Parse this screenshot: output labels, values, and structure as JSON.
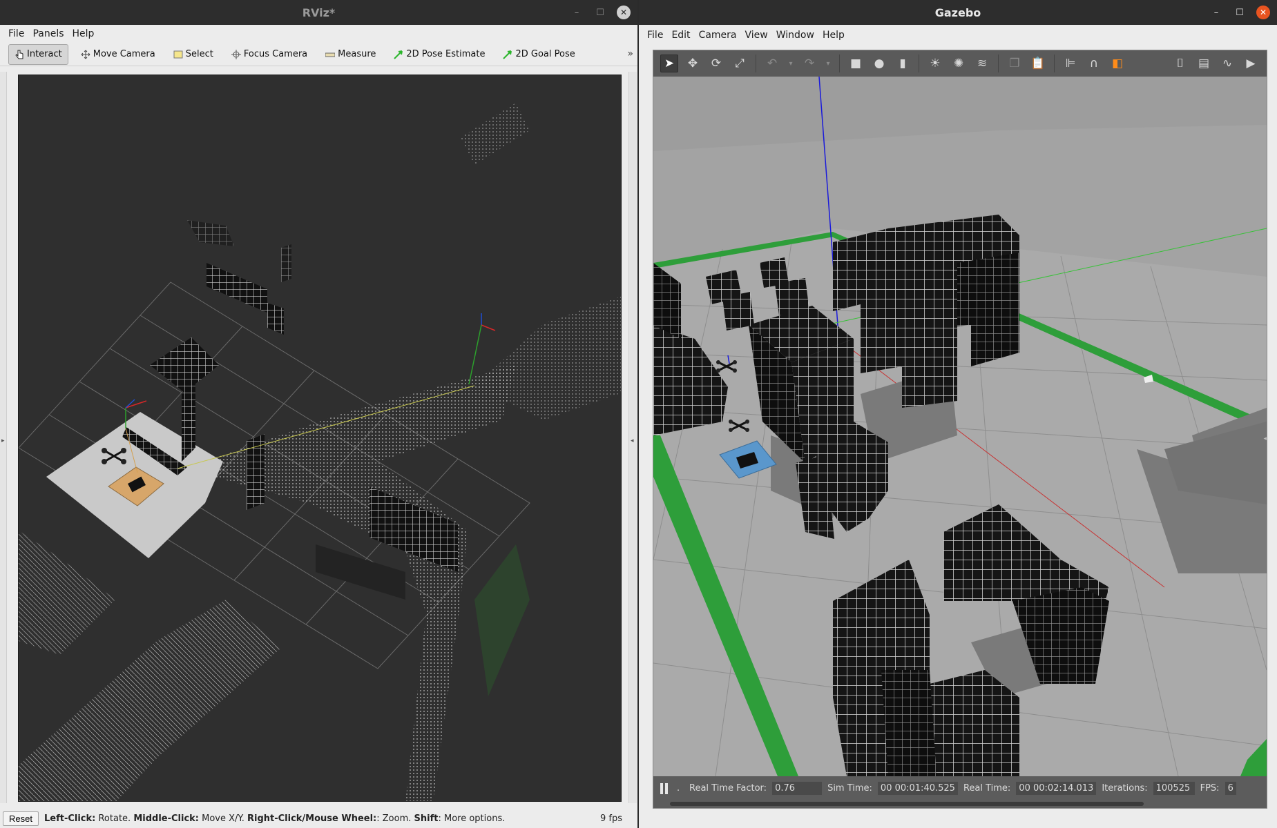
{
  "rviz": {
    "title": "RViz*",
    "menu": [
      "File",
      "Panels",
      "Help"
    ],
    "tools": [
      {
        "label": "Interact",
        "icon": "hand-cursor-icon",
        "active": true
      },
      {
        "label": "Move Camera",
        "icon": "move-arrows-icon",
        "active": false
      },
      {
        "label": "Select",
        "icon": "select-box-icon",
        "active": false
      },
      {
        "label": "Focus Camera",
        "icon": "focus-cross-icon",
        "active": false
      },
      {
        "label": "Measure",
        "icon": "ruler-icon",
        "active": false
      },
      {
        "label": "2D Pose Estimate",
        "icon": "green-arrow-icon",
        "active": false
      },
      {
        "label": "2D Goal Pose",
        "icon": "green-arrow-icon",
        "active": false
      }
    ],
    "more": "»",
    "status": {
      "reset": "Reset",
      "hint_parts": [
        {
          "bold": "Left-Click:",
          "text": " Rotate. "
        },
        {
          "bold": "Middle-Click:",
          "text": " Move X/Y. "
        },
        {
          "bold": "Right-Click/Mouse Wheel:",
          "text": ": Zoom. "
        },
        {
          "bold": "Shift",
          "text": ": More options."
        }
      ],
      "fps": "9 fps"
    }
  },
  "gazebo": {
    "title": "Gazebo",
    "menu": [
      "File",
      "Edit",
      "Camera",
      "View",
      "Window",
      "Help"
    ],
    "status": {
      "real_time_factor_label": "Real Time Factor:",
      "real_time_factor": "0.76",
      "sim_time_label": "Sim Time:",
      "sim_time": "00 00:01:40.525",
      "real_time_label": "Real Time:",
      "real_time": "00 00:02:14.013",
      "iterations_label": "Iterations:",
      "iterations": "100525",
      "fps_label": "FPS:",
      "fps": "6"
    }
  },
  "colors": {
    "titlebar": "#2d2d2d",
    "close_orange": "#e95420",
    "rviz_bg": "#2f2f2f",
    "gazebo_ground": "#a8a8a8",
    "gazebo_green": "#2e9e3a"
  }
}
